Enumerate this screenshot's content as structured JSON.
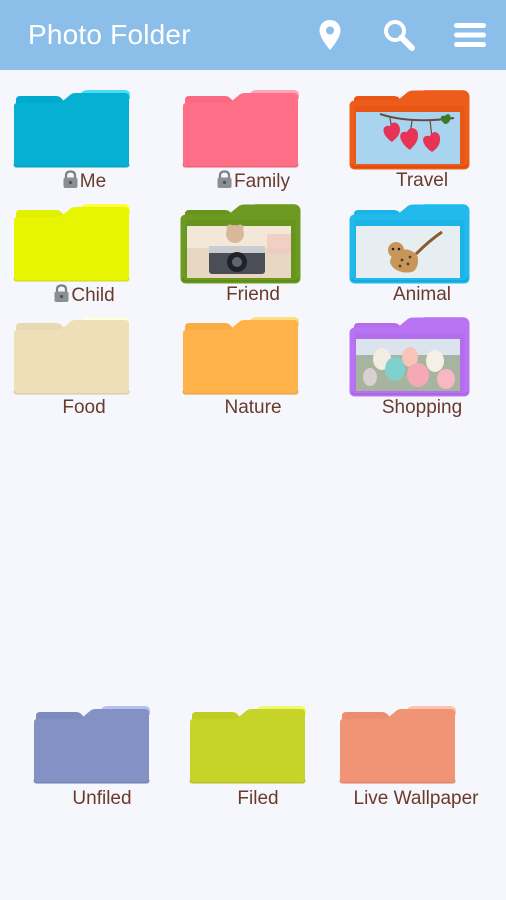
{
  "app": {
    "title": "Photo Folder",
    "bar_color": "#8bbfe9",
    "background": "#f5f7fc",
    "icons": [
      "location-pin-icon",
      "search-icon",
      "menu-icon"
    ]
  },
  "folders": [
    {
      "label": "Me",
      "color": "#06b0d3",
      "locked": true,
      "photo": null
    },
    {
      "label": "Family",
      "color": "#ff7088",
      "locked": true,
      "photo": null
    },
    {
      "label": "Travel",
      "color": "#ee5c1b",
      "locked": false,
      "photo": "hearts-photo"
    },
    {
      "label": "Child",
      "color": "#e7f500",
      "locked": true,
      "photo": null
    },
    {
      "label": "Friend",
      "color": "#6d9a22",
      "locked": false,
      "photo": "camera-photo"
    },
    {
      "label": "Animal",
      "color": "#22b9ec",
      "locked": false,
      "photo": "cheetah-photo"
    },
    {
      "label": "Food",
      "color": "#efdfb8",
      "locked": false,
      "photo": null
    },
    {
      "label": "Nature",
      "color": "#ffb24a",
      "locked": false,
      "photo": null
    },
    {
      "label": "Shopping",
      "color": "#b874f2",
      "locked": false,
      "photo": "balloons-photo"
    }
  ],
  "bottom_folders": [
    {
      "label": "Unfiled",
      "color": "#8391c4"
    },
    {
      "label": "Filed",
      "color": "#c6d42a"
    },
    {
      "label": "Live Wallpaper",
      "color": "#f19475"
    }
  ]
}
